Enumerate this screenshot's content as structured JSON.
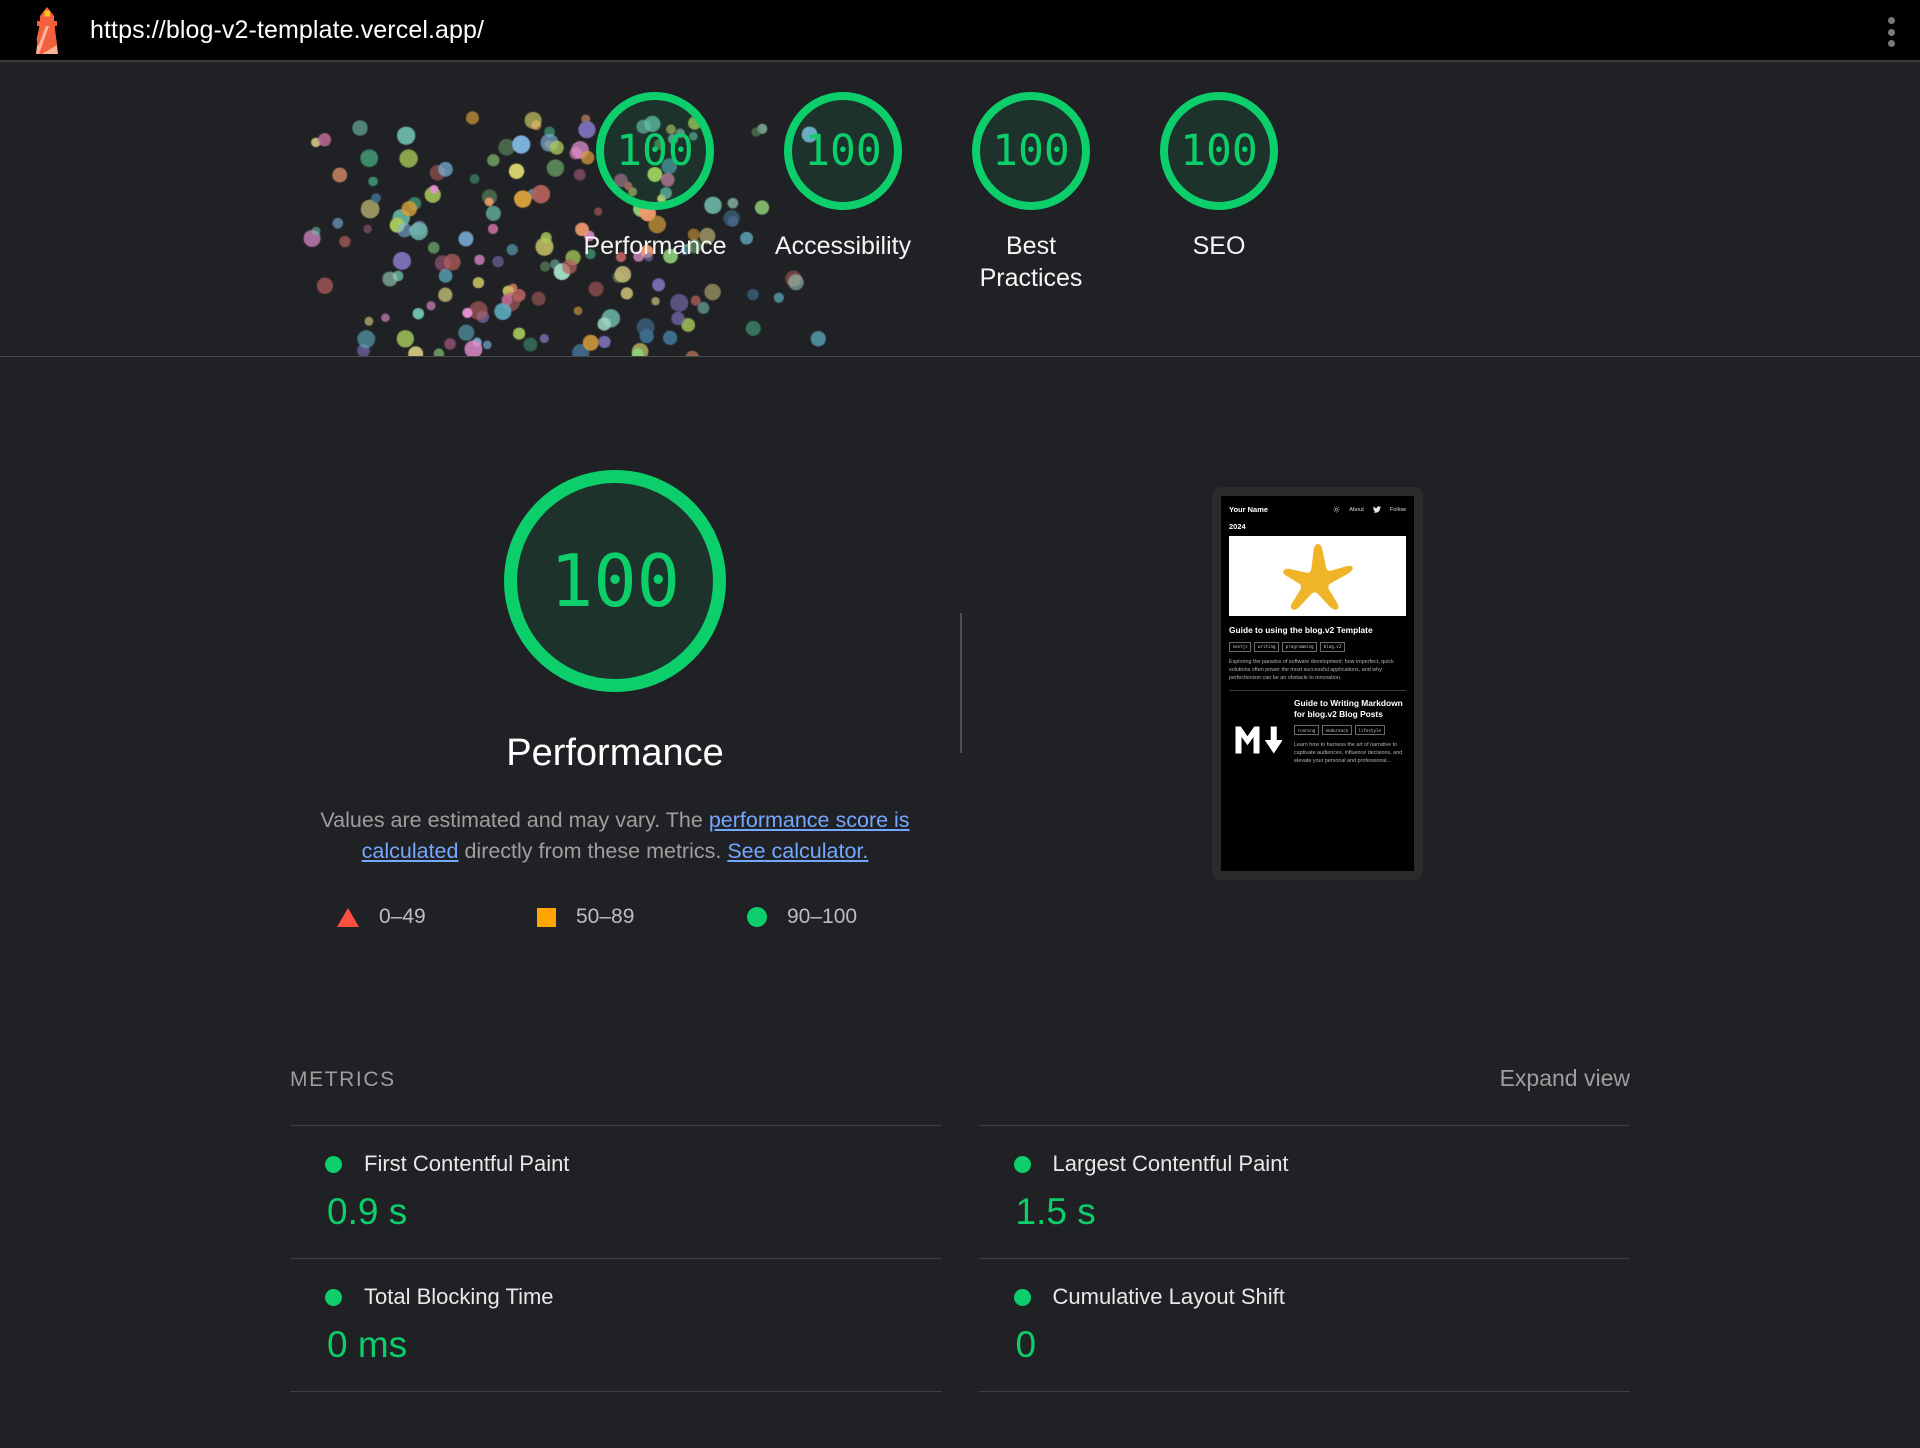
{
  "topbar": {
    "logo_icon": "lighthouse-icon",
    "url": "https://blog-v2-template.vercel.app/",
    "menu_icon": "kebab-menu-icon"
  },
  "colors": {
    "pass": "#0cce6b",
    "average": "#ffa400",
    "fail": "#ff4e42",
    "link": "#74a7ff",
    "background": "#202124"
  },
  "category_scores": [
    {
      "score": "100",
      "label": "Performance"
    },
    {
      "score": "100",
      "label": "Accessibility"
    },
    {
      "score": "100",
      "label": "Best\nPractices"
    },
    {
      "score": "100",
      "label": "SEO"
    }
  ],
  "performance": {
    "score": "100",
    "title": "Performance",
    "description_part1": "Values are estimated and may vary. The ",
    "link1": "performance score is calculated",
    "description_part2": " directly from these metrics. ",
    "link2": "See calculator."
  },
  "legend": [
    {
      "shape": "triangle",
      "range": "0–49",
      "color": "#ff4e42"
    },
    {
      "shape": "square",
      "range": "50–89",
      "color": "#ffa400"
    },
    {
      "shape": "circle",
      "range": "90–100",
      "color": "#0cce6b"
    }
  ],
  "metrics_section": {
    "title": "METRICS",
    "expand_view": "Expand view"
  },
  "metrics": {
    "left": [
      {
        "name": "First Contentful Paint",
        "value": "0.9 s",
        "status": "pass"
      },
      {
        "name": "Total Blocking Time",
        "value": "0 ms",
        "status": "pass"
      }
    ],
    "right": [
      {
        "name": "Largest Contentful Paint",
        "value": "1.5 s",
        "status": "pass"
      },
      {
        "name": "Cumulative Layout Shift",
        "value": "0",
        "status": "pass"
      }
    ]
  },
  "thumbnail": {
    "site_name": "Your Name",
    "theme_icon": "sun-icon",
    "nav_about": "About",
    "twitter_icon": "twitter-icon",
    "nav_follow": "Follow",
    "year": "2024",
    "hero_icon": "star-icon",
    "article1": {
      "title": "Guide to using the blog.v2 Template",
      "tags": [
        "nextjs",
        "writing",
        "programming",
        "blog.v2"
      ],
      "excerpt": "Exploring the paradox of software development: how imperfect, quick solutions often power the most successful applications, and why perfectionism can be an obstacle to innovation."
    },
    "article2": {
      "icon": "markdown-icon",
      "title": "Guide to Writing Markdown for blog.v2 Blog Posts",
      "tags": [
        "running",
        "endurance",
        "lifestyle"
      ],
      "excerpt": "Learn how to harness the art of narrative to captivate audiences, influence decisions, and elevate your personal and professional..."
    }
  }
}
